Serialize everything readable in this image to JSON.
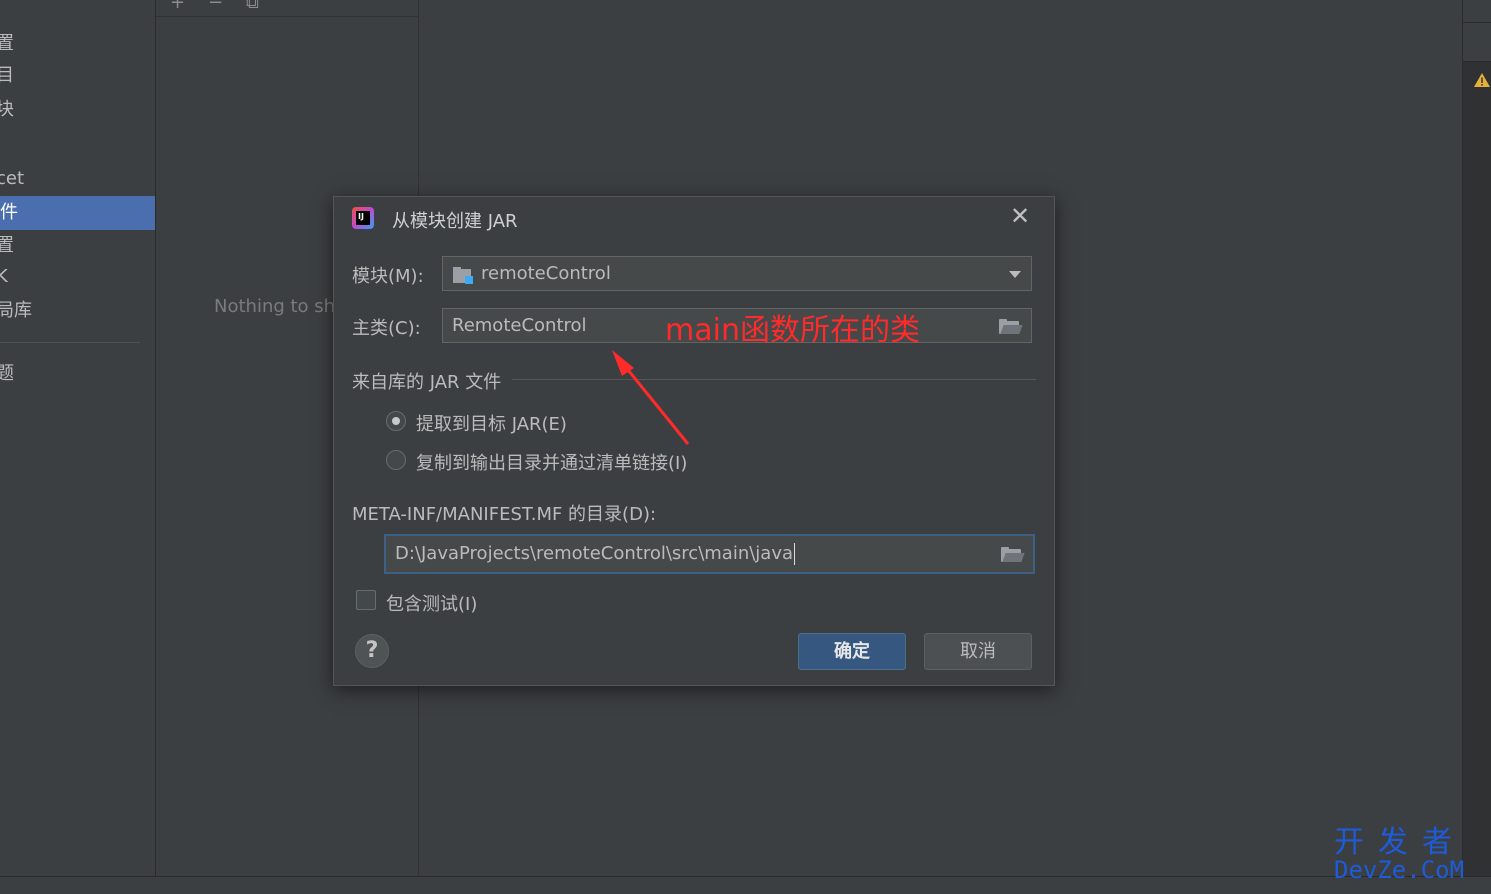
{
  "sidebar": {
    "items": [
      {
        "label": "置",
        "selected": false
      },
      {
        "label": "目",
        "selected": false
      },
      {
        "label": "块",
        "selected": false
      },
      {
        "label": "cet",
        "selected": false
      },
      {
        "label": "件",
        "selected": true
      },
      {
        "label": "置",
        "selected": false
      },
      {
        "label": "K",
        "selected": false
      },
      {
        "label": "局库",
        "selected": false
      },
      {
        "label": "题",
        "selected": false
      }
    ]
  },
  "middle": {
    "toolbar": {
      "add": "+",
      "remove": "−",
      "copy": "⧉"
    },
    "empty_text": "Nothing to sh"
  },
  "dialog": {
    "title": "从模块创建 JAR",
    "close": "✕",
    "module_label": "模块(M):",
    "module_value": "remoteControl",
    "main_class_label": "主类(C):",
    "main_class_value": "RemoteControl",
    "section_label": "来自库的 JAR 文件",
    "radio_extract": "提取到目标 JAR(E)",
    "radio_extract_selected": true,
    "radio_copy": "复制到输出目录并通过清单链接(I)",
    "radio_copy_selected": false,
    "manifest_label": "META-INF/MANIFEST.MF 的目录(D):",
    "manifest_value": "D:\\JavaProjects\\remoteControl\\src\\main\\java",
    "include_tests_label": "包含测试(I)",
    "include_tests_checked": false,
    "help": "?",
    "ok": "确定",
    "cancel": "取消"
  },
  "annotation": {
    "text": "main函数所在的类",
    "color": "#ff2b2b"
  },
  "watermark": {
    "line1": "开发者",
    "line2": "DevZe.CoM",
    "color": "#1e5bd8"
  },
  "icons": {
    "warning": "warning-icon",
    "folder": "folder-icon",
    "module": "module-icon"
  }
}
